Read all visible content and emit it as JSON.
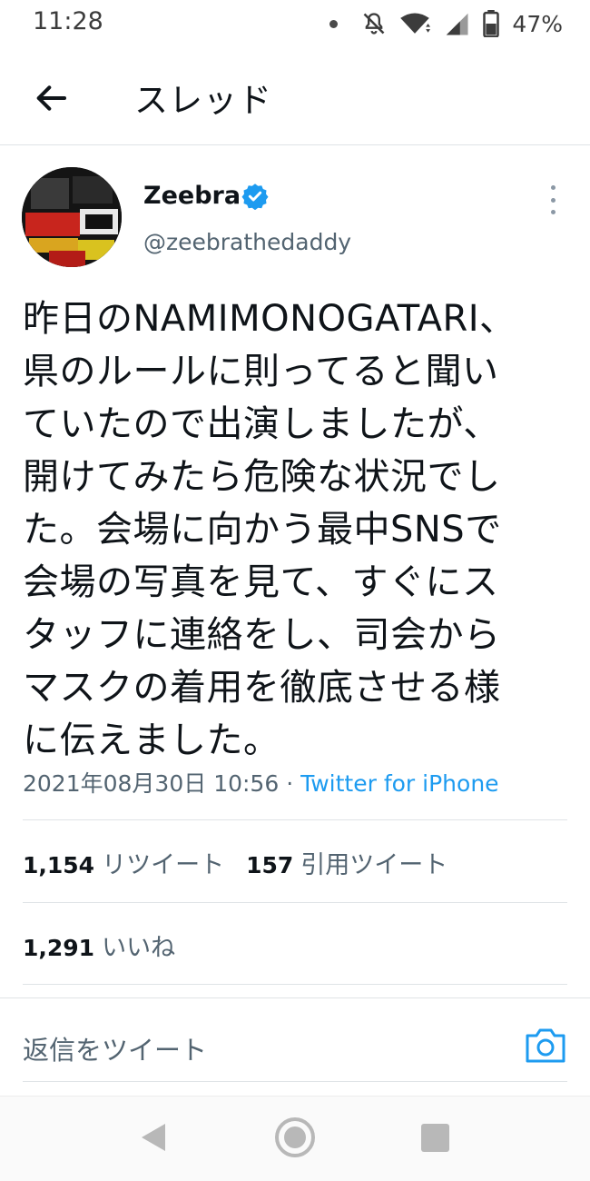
{
  "status_bar": {
    "time": "11:28",
    "battery_percent": "47%",
    "icons": [
      "dot-icon",
      "notifications-muted-icon",
      "wifi-icon",
      "signal-icon",
      "battery-icon"
    ]
  },
  "header": {
    "back_icon": "arrow-left-icon",
    "title": "スレッド"
  },
  "tweet": {
    "author_name": "Zeebra",
    "verified": true,
    "handle": "@zeebrathedaddy",
    "more_icon": "more-vertical-icon",
    "text": "昨日のNAMIMONOGATARI、\n県のルールに則ってると聞い\nていたので出演しましたが、\n開けてみたら危険な状況でし\nた。会場に向かう最中SNSで\n会場の写真を見て、すぐにス\nタッフに連絡をし、司会から\nマスクの着用を徹底させる様\nに伝えました。",
    "timestamp": "2021年08月30日 10:56",
    "separator": " · ",
    "source": "Twitter for iPhone",
    "retweets_count": "1,154",
    "retweets_label": "リツイート",
    "quotes_count": "157",
    "quotes_label": "引用ツイート",
    "likes_count": "1,291",
    "likes_label": "いいね"
  },
  "reply": {
    "placeholder": "返信をツイート",
    "camera_icon": "camera-icon"
  },
  "colors": {
    "accent": "#1d9bf0",
    "text_primary": "#0f1419",
    "text_secondary": "#536471",
    "divider": "#dfe3e6"
  },
  "nav_bar": {
    "icons": [
      "nav-back-icon",
      "nav-home-icon",
      "nav-recents-icon"
    ]
  }
}
